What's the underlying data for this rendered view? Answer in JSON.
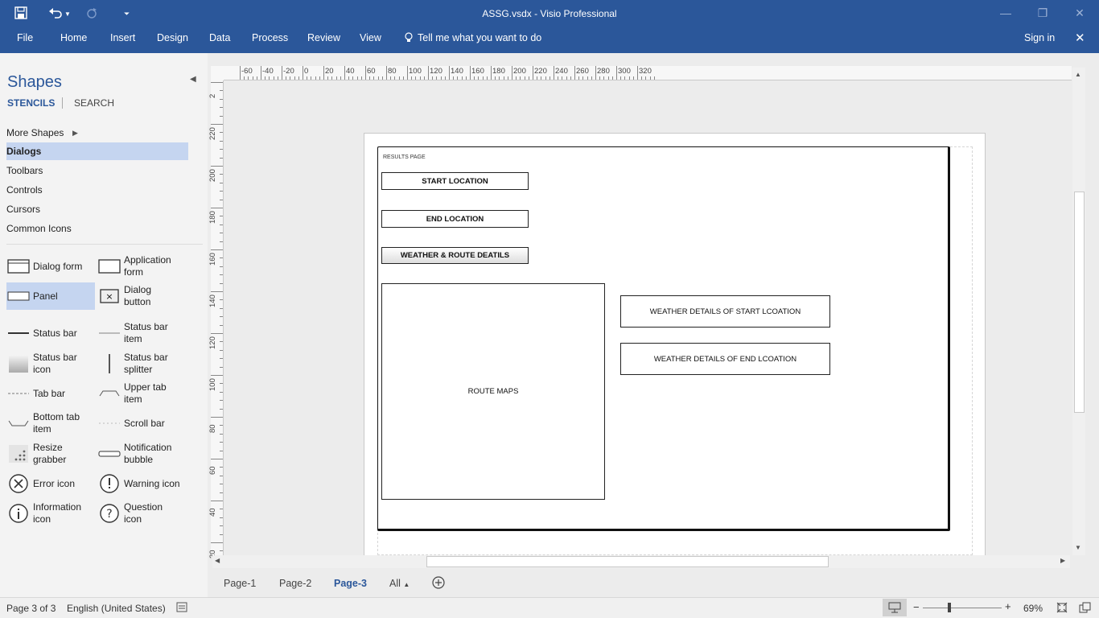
{
  "titlebar": {
    "title": "ASSG.vsdx - Visio Professional",
    "save_icon": "save-icon",
    "undo_icon": "undo-icon",
    "redo_icon": "redo-icon",
    "customize_icon": "customize-qat-icon",
    "min_icon": "minimize-icon",
    "restore_icon": "restore-icon",
    "close_icon": "close-icon"
  },
  "menu": {
    "items": [
      "File",
      "Home",
      "Insert",
      "Design",
      "Data",
      "Process",
      "Review",
      "View"
    ],
    "tell_me": "Tell me what you want to do",
    "sign_in": "Sign in",
    "close_label": "✕"
  },
  "shapes_pane": {
    "title": "Shapes",
    "tabs": [
      "STENCILS",
      "SEARCH"
    ],
    "more_shapes": "More Shapes",
    "stencils": [
      "Dialogs",
      "Toolbars",
      "Controls",
      "Cursors",
      "Common Icons"
    ],
    "selected_stencil": "Dialogs",
    "shapes": [
      [
        "Dialog form",
        ""
      ],
      [
        "Application",
        "form"
      ],
      [
        "Panel",
        ""
      ],
      [
        "Dialog",
        "button"
      ],
      [
        "Status bar",
        ""
      ],
      [
        "Status bar",
        "item"
      ],
      [
        "Status bar",
        "icon"
      ],
      [
        "Status bar",
        "splitter"
      ],
      [
        "Tab bar",
        ""
      ],
      [
        "Upper tab",
        "item"
      ],
      [
        "Bottom tab",
        "item"
      ],
      [
        "Scroll bar",
        ""
      ],
      [
        "Resize",
        "grabber"
      ],
      [
        "Notification",
        "bubble"
      ],
      [
        "Error icon",
        ""
      ],
      [
        "Warning icon",
        ""
      ],
      [
        "Information",
        "icon"
      ],
      [
        "Question",
        "icon"
      ]
    ],
    "selected_shape": "Panel"
  },
  "ruler": {
    "h_ticks": [
      "-60",
      "-40",
      "-20",
      "0",
      "20",
      "40",
      "60",
      "80",
      "100",
      "120",
      "140",
      "160",
      "180",
      "200",
      "220",
      "240",
      "260",
      "280",
      "300",
      "320"
    ],
    "v_ticks": [
      "2",
      "220",
      "200",
      "180",
      "160",
      "140",
      "120",
      "100",
      "80",
      "60",
      "40",
      "20"
    ]
  },
  "diagram": {
    "panel_title": "RESULTS PAGE",
    "start_location": "START LOCATION",
    "end_location": "END LOCATION",
    "weather_route_btn": "WEATHER & ROUTE DEATILS",
    "route_maps": "ROUTE MAPS",
    "weather_start": "WEATHER DETAILS OF START LCOATION",
    "weather_end": "WEATHER DETAILS OF END LCOATION"
  },
  "page_tabs": {
    "tabs": [
      "Page-1",
      "Page-2",
      "Page-3"
    ],
    "active": "Page-3",
    "all": "All"
  },
  "status": {
    "page": "Page 3 of 3",
    "language": "English (United States)",
    "zoom": "69%"
  }
}
